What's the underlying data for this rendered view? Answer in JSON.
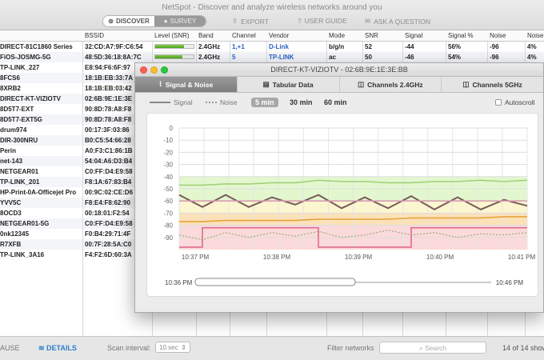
{
  "app": {
    "title": "NetSpot - Discover and analyze wireless networks around you"
  },
  "toolbar": {
    "discover": "DISCOVER",
    "survey": "SURVEY",
    "export": "EXPORT",
    "user_guide": "USER GUIDE",
    "ask_question": "ASK A QUESTION"
  },
  "table": {
    "headers": [
      "BSSID",
      "Level (SNR)",
      "Band",
      "Channel",
      "Vendor",
      "Mode",
      "SNR",
      "Signal",
      "Signal %",
      "Noise",
      "Noise"
    ],
    "rows": [
      {
        "ssid": "DIRECT-81C1860 Series",
        "bssid": "32:CD:A7:9F:C6:54",
        "level": 0.74,
        "band": "2.4GHz",
        "channel": "1,+1",
        "vendor": "D-Link",
        "mode": "b/g/n",
        "snr": "52",
        "signal": "-44",
        "signal_pct": "56%",
        "noise": "-96",
        "noise_pct": "4%"
      },
      {
        "ssid": "FiOS-JOSMG-5G",
        "bssid": "48:5D:36:18:8A:7C",
        "level": 0.7,
        "band": "2.4GHz",
        "channel": "5",
        "vendor": "TP-LINK",
        "mode": "ac",
        "snr": "50",
        "signal": "-46",
        "signal_pct": "54%",
        "noise": "-96",
        "noise_pct": "4%"
      },
      {
        "ssid": "TP-LINK_227",
        "bssid": "E8:94:F6:6F:97"
      },
      {
        "ssid": "8FCS6",
        "bssid": "18:1B:EB:33:7A"
      },
      {
        "ssid": "8XRB2",
        "bssid": "18:1B:EB:03:42"
      },
      {
        "ssid": "DIRECT-KT-VIZIOTV",
        "bssid": "02:6B:9E:1E:3E"
      },
      {
        "ssid": "8D5T7-EXT",
        "bssid": "90:8D:78:A8:F8"
      },
      {
        "ssid": "8D5T7-EXT5G",
        "bssid": "90:8D:78:A8:F8"
      },
      {
        "ssid": "drum974",
        "bssid": "00:17:3F:03:86"
      },
      {
        "ssid": "DIR-300NRU",
        "bssid": "B0:C5:54:66:28"
      },
      {
        "ssid": "Perin",
        "bssid": "A0:F3:C1:86:1B"
      },
      {
        "ssid": "net-143",
        "bssid": "54:04:A6:D3:B4"
      },
      {
        "ssid": "NETGEAR01",
        "bssid": "C0:FF:D4:E9:58"
      },
      {
        "ssid": "TP-LINK_201",
        "bssid": "F8:1A:67:83:B4"
      },
      {
        "ssid": "HP-Print-0A-Officejet Pro",
        "bssid": "00:9C:02:CE:D6"
      },
      {
        "ssid": "YVV5C",
        "bssid": "F8:E4:F8:62:90"
      },
      {
        "ssid": "8OCD3",
        "bssid": "00:18:01:F2:54"
      },
      {
        "ssid": "NETGEAR01-5G",
        "bssid": "C0:FF:D4:E9:58"
      },
      {
        "ssid": "0nk12345",
        "bssid": "F0:B4:29:71:4F"
      },
      {
        "ssid": "R7XFB",
        "bssid": "00:7F:28:5A:C0"
      },
      {
        "ssid": "TP-LINK_3A16",
        "bssid": "F4:F2:6D:60:3A"
      }
    ]
  },
  "statusbar": {
    "pause": "AUSE",
    "details": "DETAILS",
    "scan_interval_label": "Scan interval:",
    "scan_interval_value": "10 sec",
    "filter_label": "Filter networks",
    "search_placeholder": "Search",
    "count": "14 of 14 shown"
  },
  "detail": {
    "title": "DIRECT-KT-VIZIOTV - 02:6B:9E:1E:3E:BB",
    "tabs": [
      "Signal & Noise",
      "Tabular Data",
      "Channels 2.4GHz",
      "Channels 5GHz"
    ],
    "legend_signal": "Signal",
    "legend_noise": "Noise",
    "time_options": [
      "5 min",
      "30 min",
      "60 min"
    ],
    "autoscroll": "Autoscroll",
    "range_start": "10:36 PM",
    "range_end": "10:46 PM"
  },
  "colors": {
    "green_zone": "#e3f7cf",
    "yellow_zone": "#fbf6cf",
    "red_zone": "#fadada",
    "orange_zone": "#fbe1b8"
  },
  "chart_data": {
    "type": "line",
    "y_ticks": [
      "0",
      "-10",
      "-20",
      "-30",
      "-40",
      "-50",
      "-60",
      "-70",
      "-80",
      "-90"
    ],
    "ylim": [
      -100,
      0
    ],
    "x_ticks": [
      "10:37 PM",
      "10:38 PM",
      "10:39 PM",
      "10:40 PM",
      "10:41 PM"
    ],
    "series": [
      {
        "color": "#a3d07a",
        "values": [
          -47,
          -47,
          -46,
          -46,
          -45,
          -45,
          -43,
          -44,
          -44,
          -45,
          -45,
          -44,
          -44,
          -43,
          -44,
          -43
        ]
      },
      {
        "color": "#7a5a5a",
        "values": [
          -55,
          -65,
          -55,
          -65,
          -57,
          -63,
          -55,
          -66,
          -57,
          -66,
          -56,
          -67,
          -57,
          -67,
          -59,
          -64
        ]
      },
      {
        "color": "#d89bb0",
        "values": [
          -60,
          -60,
          -60,
          -60,
          -60,
          -60,
          -60,
          -60,
          -60,
          -60,
          -60,
          -60,
          -60,
          -60,
          -60,
          -60
        ]
      },
      {
        "color": "#e8a23a",
        "values": [
          -77,
          -77,
          -76,
          -76,
          -76,
          -76,
          -75,
          -75,
          -75,
          -75,
          -74,
          -74,
          -74,
          -74,
          -73,
          -73
        ]
      },
      {
        "color": "#e06a8f",
        "values": [
          -98,
          -82,
          -82,
          -82,
          -82,
          -82,
          -98,
          -98,
          -98,
          -98,
          -82,
          -82,
          -82,
          -82,
          -82,
          -82
        ]
      }
    ]
  }
}
